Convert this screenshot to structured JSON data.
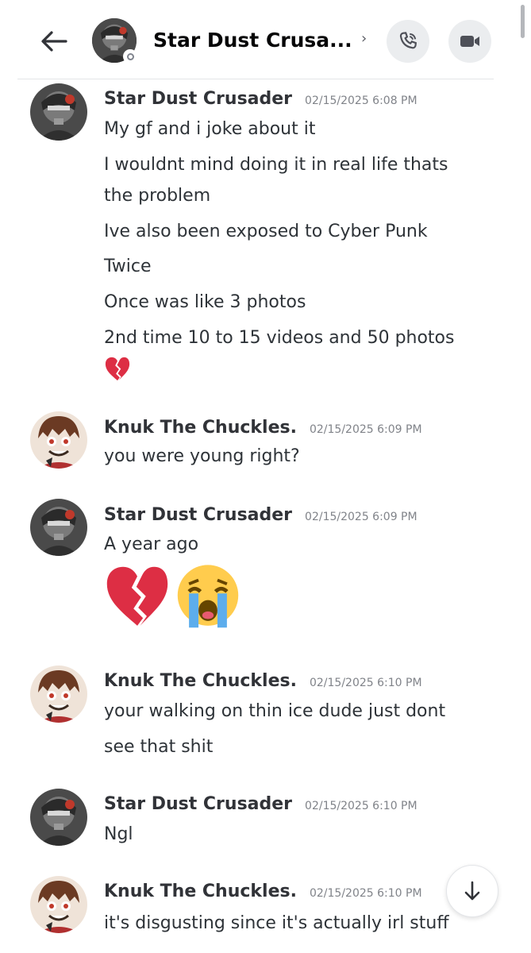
{
  "header": {
    "title": "Star Dust Crusa...",
    "chevron": "›",
    "status": "offline",
    "icons": [
      "back-arrow-icon",
      "phone-icon",
      "video-camera-icon"
    ]
  },
  "messages": [
    {
      "author": "Star Dust Crusader",
      "timestamp": "02/15/2025 6:08 PM",
      "lines": [
        "My gf and i joke about it",
        "I wouldnt mind doing it in real life thats",
        "the problem",
        "Ive also been exposed to Cyber Punk",
        "Twice",
        "Once was like 3 photos",
        "2nd time 10 to 15 videos and 50 photos"
      ],
      "emoji": [
        "broken-heart"
      ]
    },
    {
      "author": "Knuk The Chuckles.",
      "timestamp": "02/15/2025 6:09 PM",
      "lines": [
        "you were young right?"
      ]
    },
    {
      "author": "Star Dust Crusader",
      "timestamp": "02/15/2025 6:09 PM",
      "lines": [
        "A year ago"
      ],
      "emoji": [
        "broken-heart",
        "crying-face"
      ]
    },
    {
      "author": "Knuk The Chuckles.",
      "timestamp": "02/15/2025 6:10 PM",
      "lines": [
        "your walking on thin ice dude just dont",
        "see that shit"
      ]
    },
    {
      "author": "Star Dust Crusader",
      "timestamp": "02/15/2025 6:10 PM",
      "lines": [
        "Ngl"
      ]
    },
    {
      "author": "Knuk The Chuckles.",
      "timestamp": "02/15/2025 6:10 PM",
      "lines": [
        "it's disgusting since it's actually irl stuff"
      ]
    }
  ],
  "colors": {
    "background": "#ffffff",
    "text": "#2e3338",
    "author": "#313338",
    "timestamp": "#808389",
    "heart": "#dd2e44",
    "crying_face": "#ffcc4d",
    "tears": "#5dadec"
  }
}
